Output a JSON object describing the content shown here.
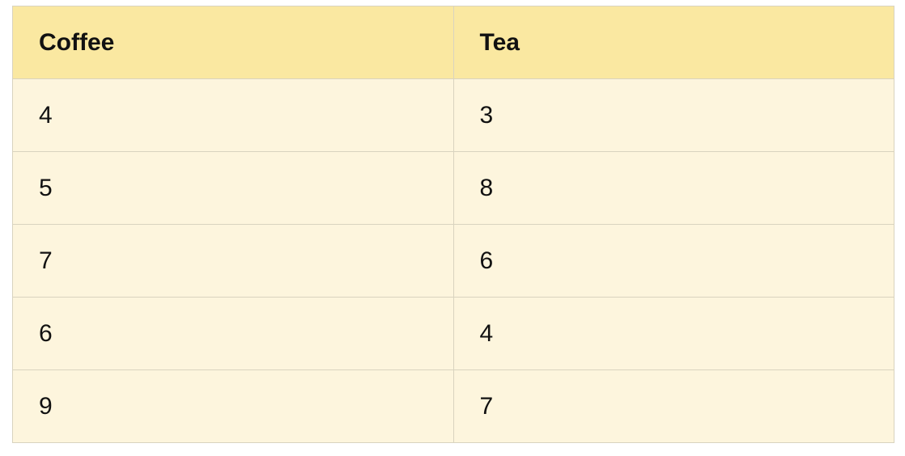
{
  "table": {
    "headers": [
      "Coffee",
      "Tea"
    ],
    "rows": [
      [
        "4",
        "3"
      ],
      [
        "5",
        "8"
      ],
      [
        "7",
        "6"
      ],
      [
        "6",
        "4"
      ],
      [
        "9",
        "7"
      ]
    ]
  },
  "colors": {
    "header_background": "#fae8a1",
    "row_background": "#fdf5dd",
    "border": "#d9d3bf",
    "text": "#111111"
  }
}
